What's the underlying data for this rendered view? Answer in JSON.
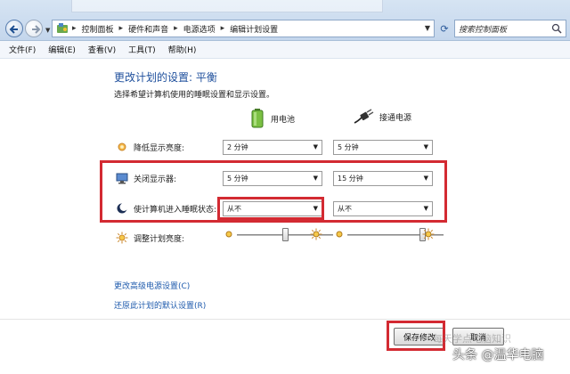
{
  "address": {
    "breadcrumbs": [
      "控制面板",
      "硬件和声音",
      "电源选项",
      "编辑计划设置"
    ],
    "search_placeholder": "搜索控制面板"
  },
  "menu": [
    "文件(F)",
    "编辑(E)",
    "查看(V)",
    "工具(T)",
    "帮助(H)"
  ],
  "page": {
    "title": "更改计划的设置: 平衡",
    "subtitle": "选择希望计算机使用的睡眠设置和显示设置。",
    "col_battery": "用电池",
    "col_ac": "接通电源"
  },
  "settings": [
    {
      "label": "降低显示亮度:",
      "battery": "2 分钟",
      "ac": "5 分钟"
    },
    {
      "label": "关闭显示器:",
      "battery": "5 分钟",
      "ac": "15 分钟"
    },
    {
      "label": "使计算机进入睡眠状态:",
      "battery": "从不",
      "ac": "从不"
    }
  ],
  "brightness": {
    "label": "调整计划亮度:",
    "battery_level": 0.5,
    "ac_level": 0.8
  },
  "links": {
    "advanced": "更改高级电源设置(C)",
    "restore": "还原此计划的默认设置(R)"
  },
  "buttons": {
    "save": "保存修改",
    "cancel": "取消"
  },
  "watermark": {
    "line1": "每天学点电脑知识",
    "line2": "头条 @温华电脑"
  },
  "colors": {
    "highlight": "#d32a32",
    "title": "#1e4f9c",
    "link": "#1f5bad"
  }
}
